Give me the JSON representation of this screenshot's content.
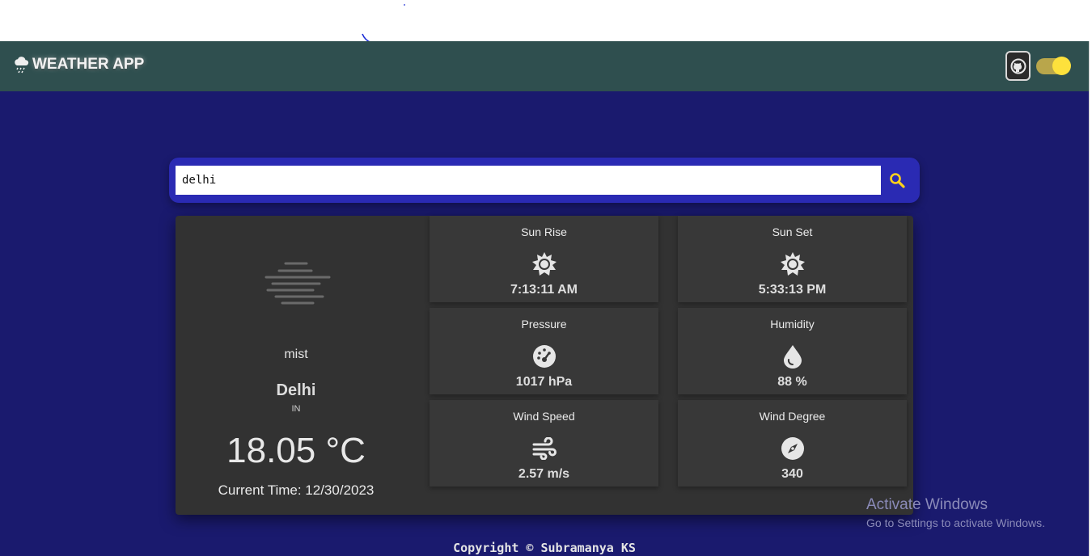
{
  "header": {
    "title": "WEATHER APP",
    "logo_icon": "cloud-rain-icon",
    "github_icon": "github-icon",
    "theme_toggle": {
      "state": "on",
      "color": "#fde13c"
    }
  },
  "search": {
    "value": "delhi",
    "button_icon": "search-icon",
    "accent": "#2a2ab3"
  },
  "weather": {
    "condition": "mist",
    "condition_icon": "mist-icon",
    "city": "Delhi",
    "country": "IN",
    "temperature": "18.05 °C",
    "current_time": "Current Time: 12/30/2023"
  },
  "details": [
    {
      "label": "Sun Rise",
      "icon": "sun-icon",
      "value": "7:13:11 AM"
    },
    {
      "label": "Sun Set",
      "icon": "sun-icon",
      "value": "5:33:13 PM"
    },
    {
      "label": "Pressure",
      "icon": "gauge-icon",
      "value": "1017 hPa"
    },
    {
      "label": "Humidity",
      "icon": "droplet-icon",
      "value": "88 %"
    },
    {
      "label": "Wind Speed",
      "icon": "wind-icon",
      "value": "2.57 m/s"
    },
    {
      "label": "Wind Degree",
      "icon": "compass-icon",
      "value": "340"
    }
  ],
  "watermark": {
    "line1": "Activate Windows",
    "line2": "Go to Settings to activate Windows."
  },
  "footer": {
    "copyright": "Copyright © Subramanya KS"
  },
  "colors": {
    "navbar": "#2f4f4f",
    "background": "#1a1a6e",
    "card": "#323232"
  }
}
